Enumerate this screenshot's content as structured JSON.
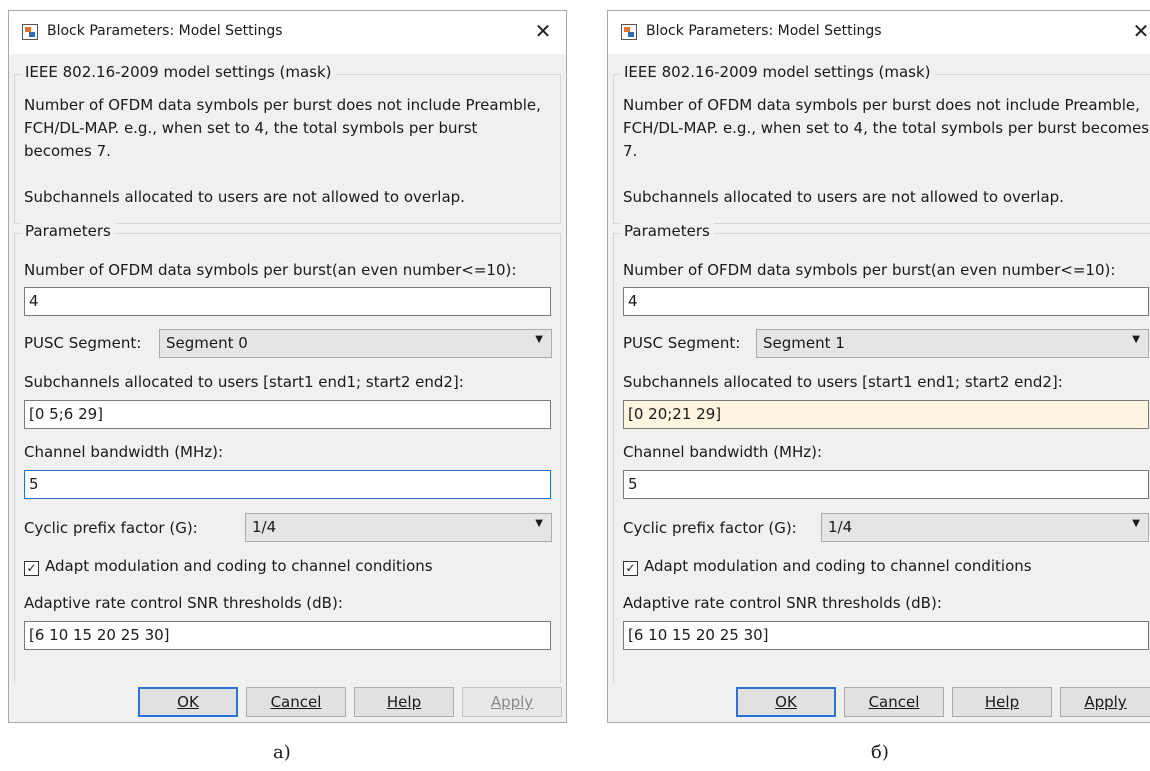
{
  "dialogs": [
    {
      "title": "Block Parameters: Model Settings",
      "close_glyph": "✕",
      "mask_group_label": "IEEE 802.16-2009 model settings (mask)",
      "description": "Number of OFDM data symbols per burst does not include Preamble, FCH/DL-MAP. e.g., when set to 4, the total symbols per burst becomes 7.\n\nSubchannels allocated to users are not allowed to overlap.",
      "params_group_label": "Parameters",
      "symbols_label": "Number of OFDM data symbols per burst(an even number<=10):",
      "symbols_value": "4",
      "pusc_label": "PUSC Segment:",
      "pusc_value": "Segment 0",
      "subchannels_label": "Subchannels allocated to users [start1 end1; start2 end2]:",
      "subchannels_value": "[0 5;6 29]",
      "bandwidth_label": "Channel bandwidth (MHz):",
      "bandwidth_value": "5",
      "cp_label": "Cyclic prefix factor (G):",
      "cp_value": "1/4",
      "adapt_label": "Adapt modulation and coding to channel conditions",
      "adapt_checked": true,
      "snr_label": "Adaptive rate control SNR thresholds (dB):",
      "snr_value": "[6 10 15 20 25 30]",
      "buttons": {
        "ok": "OK",
        "cancel": "Cancel",
        "help": "Help",
        "apply": "Apply"
      }
    },
    {
      "title": "Block Parameters: Model Settings",
      "close_glyph": "✕",
      "mask_group_label": "IEEE 802.16-2009 model settings (mask)",
      "description": "Number of OFDM data symbols per burst does not include Preamble, FCH/DL-MAP. e.g., when set to 4, the total symbols per burst becomes 7.\n\nSubchannels allocated to users are not allowed to overlap.",
      "params_group_label": "Parameters",
      "symbols_label": "Number of OFDM data symbols per burst(an even number<=10):",
      "symbols_value": "4",
      "pusc_label": "PUSC Segment:",
      "pusc_value": "Segment 1",
      "subchannels_label": "Subchannels allocated to users [start1 end1; start2 end2]:",
      "subchannels_value": "[0 20;21 29]",
      "bandwidth_label": "Channel bandwidth (MHz):",
      "bandwidth_value": "5",
      "cp_label": "Cyclic prefix factor (G):",
      "cp_value": "1/4",
      "adapt_label": "Adapt modulation and coding to channel conditions",
      "adapt_checked": true,
      "snr_label": "Adaptive rate control SNR thresholds (dB):",
      "snr_value": "[6 10 15 20 25 30]",
      "buttons": {
        "ok": "OK",
        "cancel": "Cancel",
        "help": "Help",
        "apply": "Apply"
      }
    }
  ],
  "captions": [
    "а)",
    "б)"
  ],
  "colors": {
    "apply_disabled": "#8a8a8a",
    "highlight_field": "#fff4e0",
    "focus_border": "#2d6ec8"
  }
}
